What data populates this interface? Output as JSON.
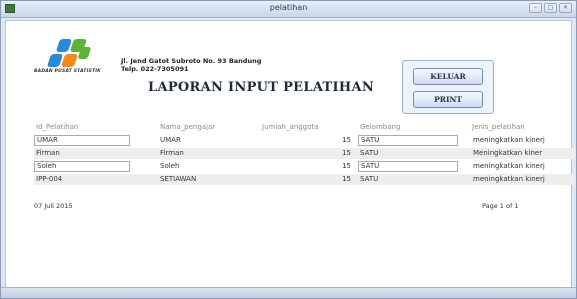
{
  "window": {
    "title": "pelatihan",
    "controls": [
      "minimize-icon",
      "maximize-icon",
      "close-icon"
    ]
  },
  "header": {
    "org_name": "BADAN PUSAT STATISTIK",
    "address_line1": "Jl. Jend Gatot Subroto No. 93 Bandung",
    "address_line2": "Telp. 022-7305091",
    "report_title": "LAPORAN INPUT PELATIHAN",
    "logo_colors": {
      "blue": "#2a8ad8",
      "green": "#5db33a",
      "orange": "#f08a1c"
    }
  },
  "buttons": {
    "keluar": "KELUAR",
    "print": "PRINT"
  },
  "table": {
    "columns": [
      "Id_Pelatihan",
      "Nama_pengajar",
      "Jumlah_anggota",
      "Gelombang",
      "Jenis_pelatihan"
    ],
    "rows": [
      {
        "id": "UMAR",
        "pengajar": "UMAR",
        "jumlah": "15",
        "gelombang": "SATU",
        "jenis": "meningkatkan kinerj"
      },
      {
        "id": "Firman",
        "pengajar": "Firman",
        "jumlah": "15",
        "gelombang": "SATU",
        "jenis": "Meningkatkan kiner"
      },
      {
        "id": "Soleh",
        "pengajar": "Soleh",
        "jumlah": "15",
        "gelombang": "SATU",
        "jenis": "meningkatkan kinerj"
      },
      {
        "id": "IPP-004",
        "pengajar": "SETIAWAN",
        "jumlah": "15",
        "gelombang": "SATU",
        "jenis": "meningkatkan kinerj"
      }
    ]
  },
  "footer": {
    "date": "07 Juli 2015",
    "page": "Page 1 of 1"
  }
}
